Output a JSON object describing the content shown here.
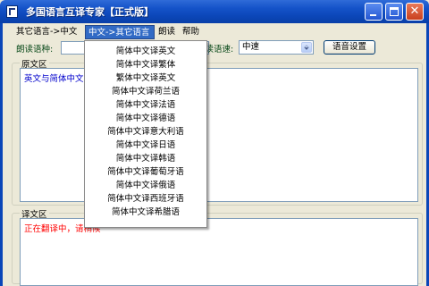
{
  "window": {
    "title": "多国语言互译专家【正式版】",
    "close_glyph": "✕"
  },
  "menubar": {
    "items": [
      "其它语言->中文",
      "中文->其它语言",
      "朗读",
      "帮助"
    ],
    "active_index": 1
  },
  "toolbar": {
    "read_language_label": "朗读语种:",
    "read_speed_label": "朗读语速:",
    "read_speed_value": "中速",
    "combo_arrow": "⬙",
    "voice_settings_label": "语音设置"
  },
  "source": {
    "title": "原文区",
    "text": "英文与简体中文互译"
  },
  "target": {
    "title": "译文区",
    "text": "正在翻译中，请稍候",
    "text_color": "#ff0000"
  },
  "dropdown": {
    "items": [
      "简体中文译英文",
      "简体中文译繁体",
      "繁体中文译英文",
      "简体中文译荷兰语",
      "简体中文译法语",
      "简体中文译德语",
      "简体中文译意大利语",
      "简体中文译日语",
      "简体中文译韩语",
      "简体中文译葡萄牙语",
      "简体中文译俄语",
      "简体中文译西班牙语",
      "简体中文译希腊语"
    ]
  },
  "colors": {
    "titlebar": "#0b46b8",
    "menu_highlight": "#316ac5",
    "window_bg": "#ece9d8"
  }
}
